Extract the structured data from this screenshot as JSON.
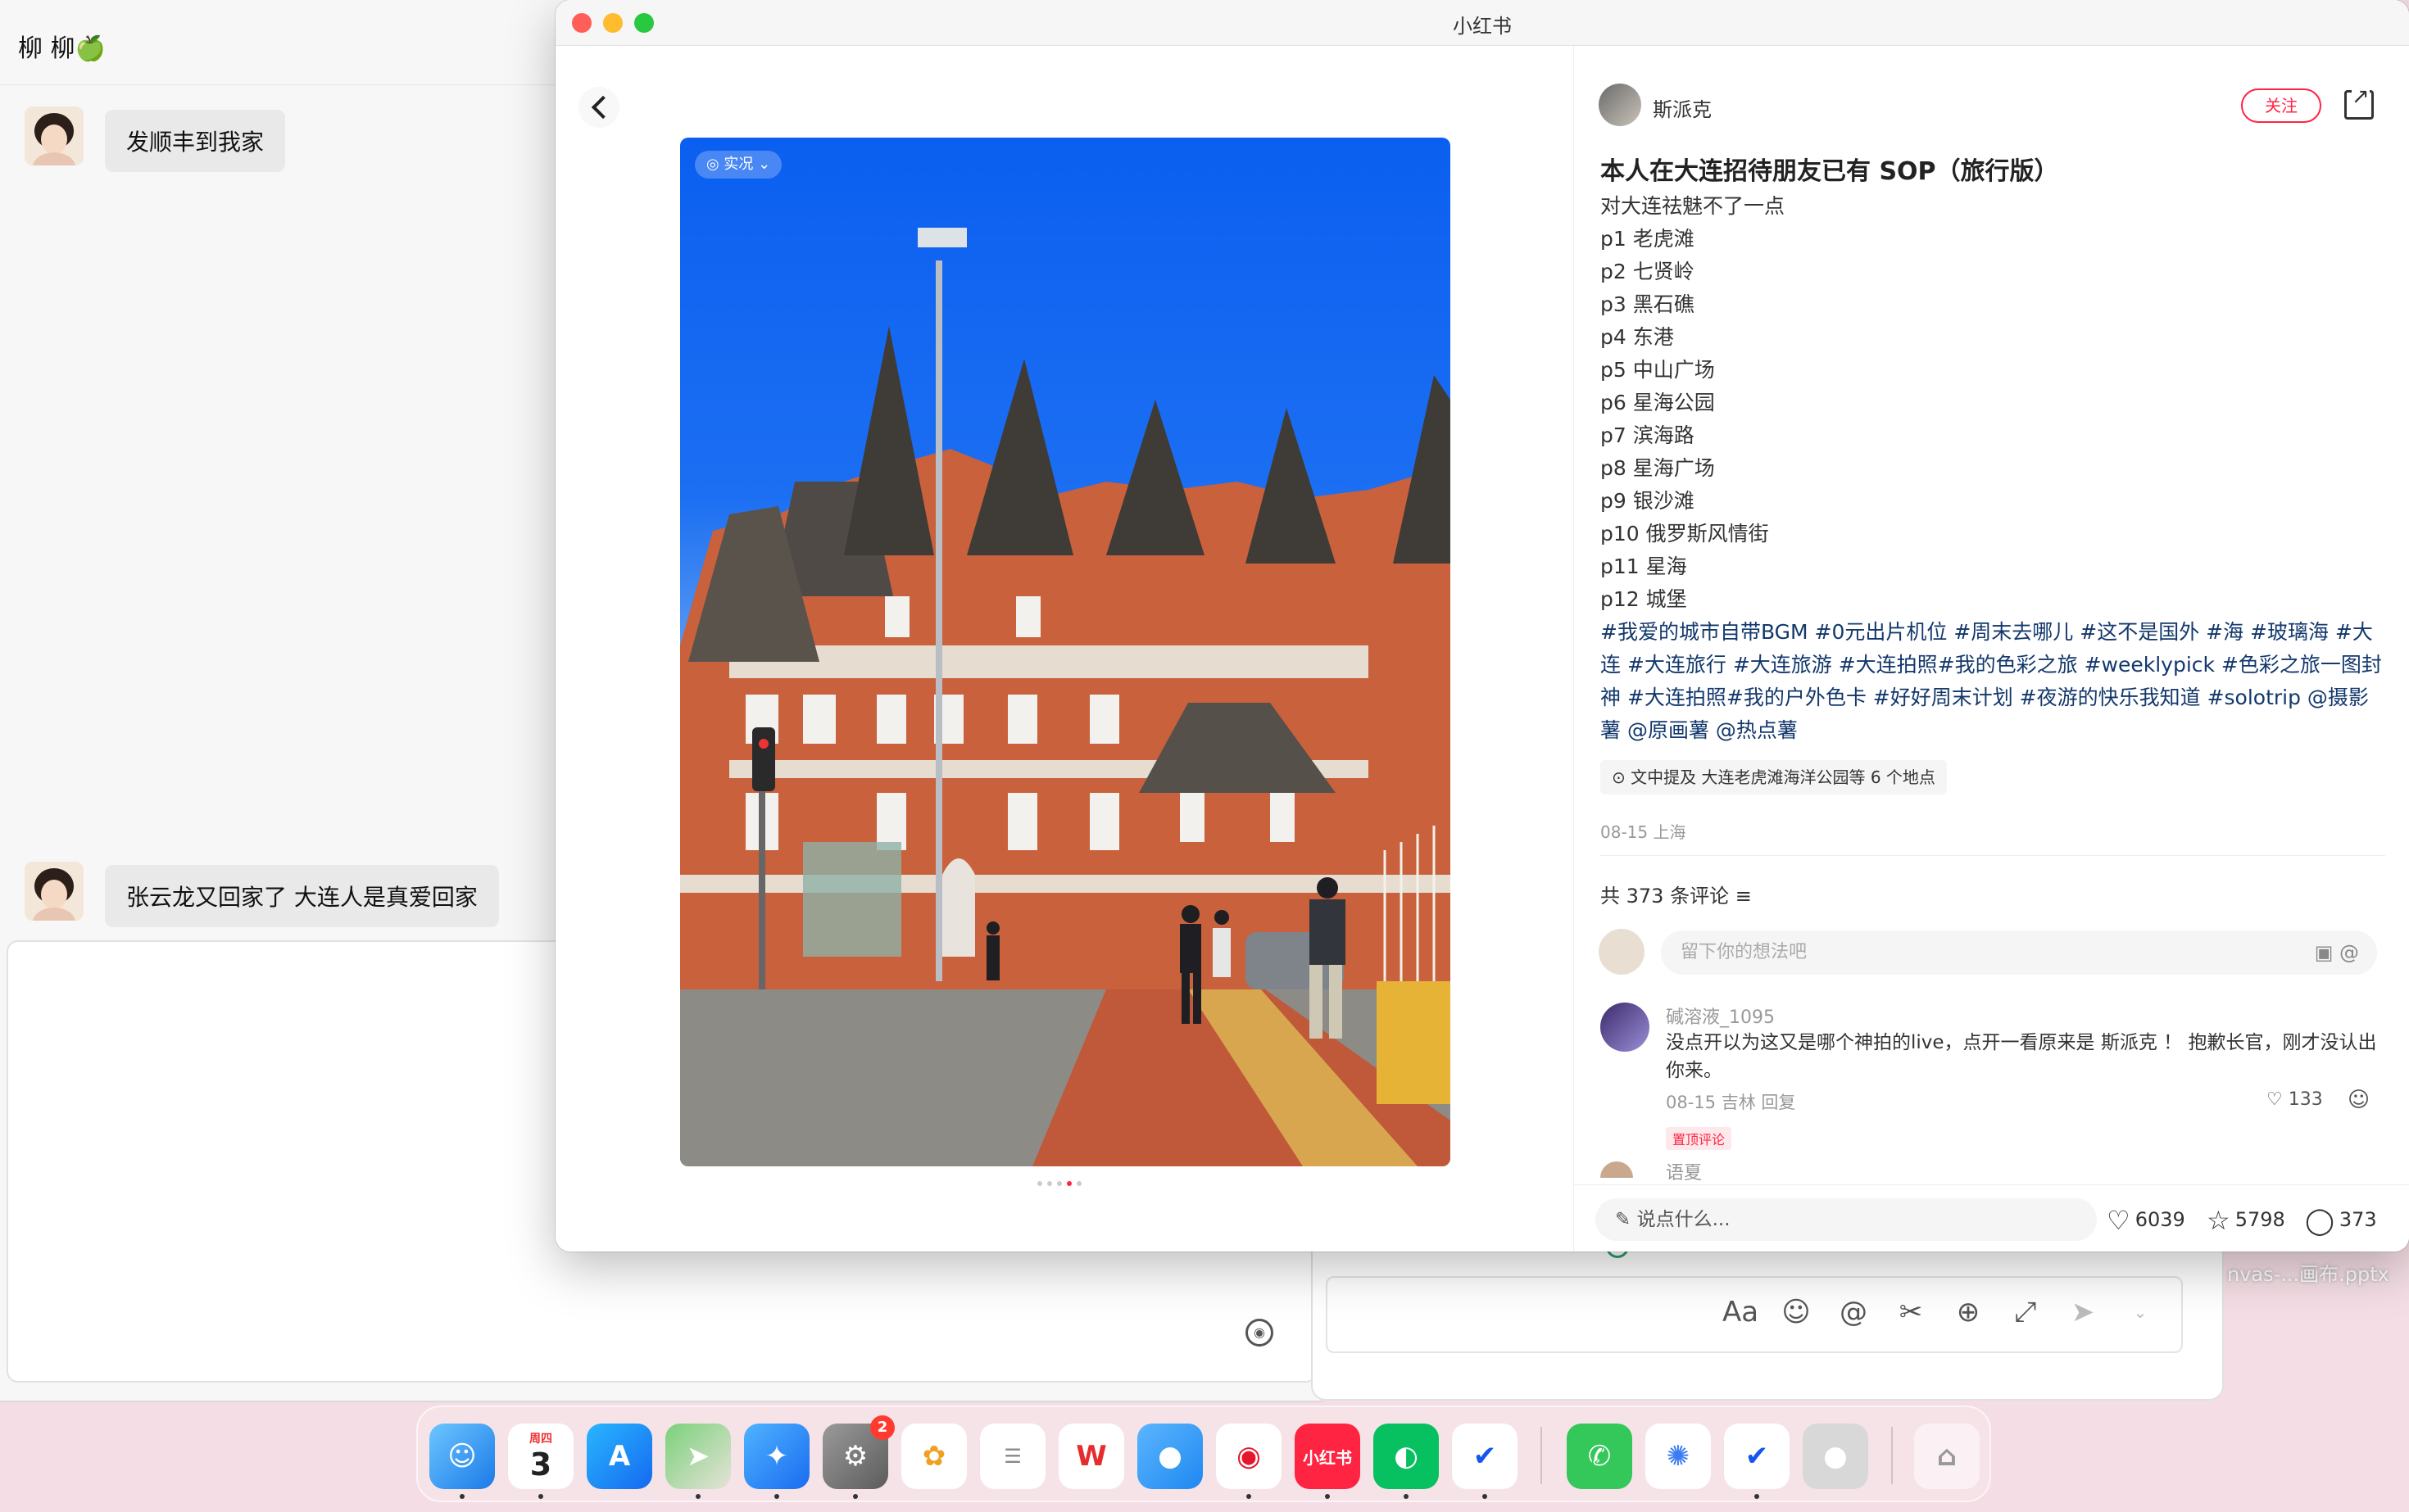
{
  "chat": {
    "title": "柳 柳🍏",
    "messages": [
      {
        "text": "发顺丰到我家"
      },
      {
        "text": "张云龙又回家了 大连人是真爱回家"
      }
    ]
  },
  "composer": {
    "file_label": "nvas-...画布.pptx"
  },
  "window": {
    "title": "小红书"
  },
  "photo": {
    "live_badge": "◎ 实况 ⌄"
  },
  "note": {
    "author": "斯派克",
    "follow_label": "关注",
    "title": "本人在大连招待朋友已有 SOP（旅行版）",
    "lines": [
      "对大连祛魅不了一点",
      "p1 老虎滩",
      "p2 七贤岭",
      "p3 黑石礁",
      "p4 东港",
      "p5 中山广场",
      "p6 星海公园",
      "p7 滨海路",
      "p8 星海广场",
      "p9 银沙滩",
      "p10 俄罗斯风情街",
      "p11 星海",
      "p12 城堡"
    ],
    "tags": "#我爱的城市自带BGM #0元出片机位 #周末去哪儿 #这不是国外 #海 #玻璃海 #大连 #大连旅行 #大连旅游 #大连拍照#我的色彩之旅 #weeklypick #色彩之旅一图封神 #大连拍照#我的户外色卡 #好好周末计划 #夜游的快乐我知道 #solotrip @摄影薯 @原画薯 @热点薯",
    "location_chip": "⊙ 文中提及   大连老虎滩海洋公园等 6 个地点",
    "date": "08-15 上海"
  },
  "comments": {
    "count_label": "共 373 条评论 ≡",
    "input_placeholder": "留下你的想法吧",
    "items": [
      {
        "user": "碱溶液_1095",
        "text": "没点开以为这又是哪个神拍的live，点开一看原来是   斯派克   ！  抱歉长官，刚才没认出你来。",
        "meta": "08-15 吉林   回复",
        "likes": "♡ 133",
        "pin": "置顶评论"
      },
      {
        "user": "语夏"
      }
    ]
  },
  "bottom_bar": {
    "say_placeholder": "✎ 说点什么...",
    "likes": "6039",
    "collects": "5798",
    "comments": "373"
  },
  "dock": {
    "calendar_day": "3",
    "calendar_weekday": "周四",
    "settings_badge": "2",
    "xhs_label": "小红书",
    "apps": [
      "finder",
      "calendar",
      "app-store",
      "maps",
      "safari",
      "settings",
      "photos",
      "reminders",
      "wps",
      "messages-bubble",
      "weibo",
      "xiaohongshu",
      "wechat",
      "feishu",
      "phone",
      "mapp",
      "feishu-meeting",
      "user",
      "trash"
    ]
  },
  "colors": {
    "accent": "#ff2442",
    "tag_blue": "#13386c"
  }
}
